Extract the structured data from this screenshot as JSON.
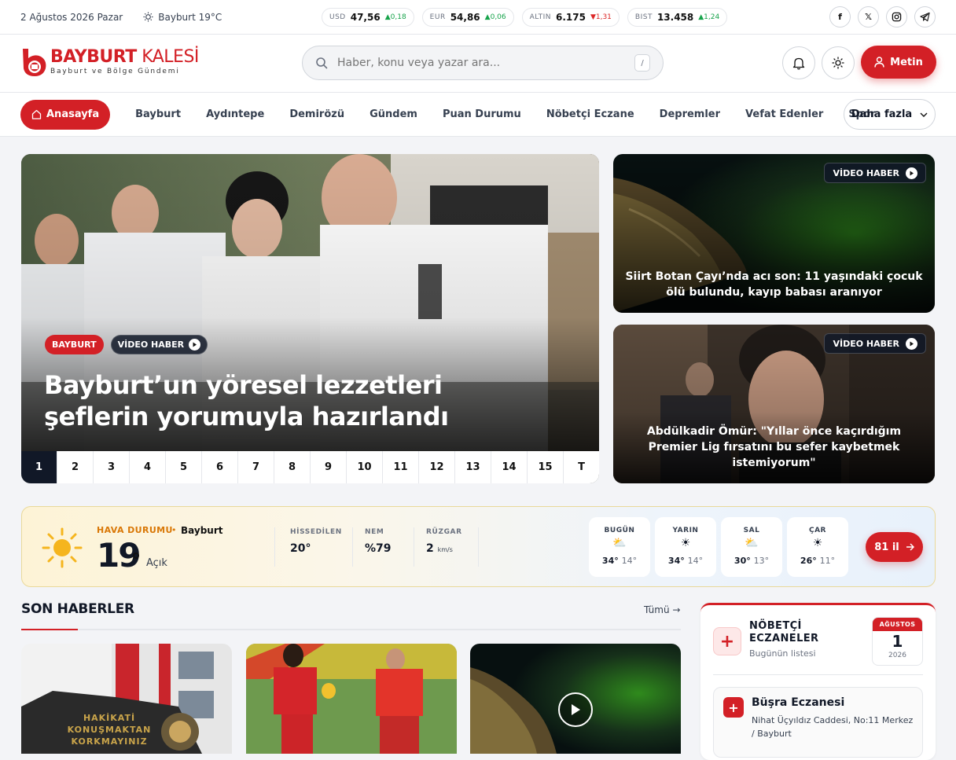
{
  "topbar": {
    "date": "2 Ağustos 2026 Pazar",
    "weather": "Bayburt 19°C",
    "tickers": [
      {
        "label": "USD",
        "value": "47,56",
        "change": "▲0,18",
        "dir": "up"
      },
      {
        "label": "EUR",
        "value": "54,86",
        "change": "▲0,06",
        "dir": "up"
      },
      {
        "label": "ALTIN",
        "value": "6.175",
        "change": "▼1,31",
        "dir": "down"
      },
      {
        "label": "BIST",
        "value": "13.458",
        "change": "▲1,24",
        "dir": "up"
      }
    ],
    "socials": [
      "facebook-icon",
      "x-icon",
      "instagram-icon",
      "telegram-icon"
    ]
  },
  "header": {
    "logo_title_bold": "BAYBURT",
    "logo_title_light": " KALESİ",
    "logo_subtitle": "Bayburt ve Bölge Gündemi",
    "search_placeholder": "Haber, konu veya yazar ara...",
    "search_shortcut": "/",
    "login_label": "Metin"
  },
  "nav": {
    "home": "Anasayfa",
    "items": [
      "Bayburt",
      "Aydıntepe",
      "Demirözü",
      "Gündem",
      "Puan Durumu",
      "Nöbetçi Eczane",
      "Depremler",
      "Vefat Edenler",
      "Spor"
    ],
    "more": "Daha fazla"
  },
  "hero": {
    "category": "BAYBURT",
    "video_tag": "VİDEO HABER",
    "title": "Bayburt’un yöresel lezzetleri şeflerin yorumuyla hazırlandı",
    "pages": [
      "1",
      "2",
      "3",
      "4",
      "5",
      "6",
      "7",
      "8",
      "9",
      "10",
      "11",
      "12",
      "13",
      "14",
      "15",
      "T"
    ],
    "active_page": "1"
  },
  "side_news": [
    {
      "tag": "VİDEO HABER",
      "title": "Siirt Botan Çayı’nda acı son: 11 yaşındaki çocuk ölü bulundu, kayıp babası aranıyor"
    },
    {
      "tag": "VİDEO HABER",
      "title": "Abdülkadir Ömür: \"Yıllar önce kaçırdığım Premier Lig fırsatını bu sefer kaybetmek istemiyorum\""
    }
  ],
  "weather": {
    "label": "HAVA DURUMU",
    "city": "Bayburt",
    "temp": "19",
    "desc": "Açık",
    "stats": [
      {
        "key": "HİSSEDİLEN",
        "value": "20°",
        "unit": ""
      },
      {
        "key": "NEM",
        "value": "%79",
        "unit": ""
      },
      {
        "key": "RÜZGAR",
        "value": "2",
        "unit": "km/s"
      }
    ],
    "forecast": [
      {
        "day": "BUGÜN",
        "icon": "partly-cloudy-icon",
        "glyph": "⛅",
        "high": "34°",
        "low": "14°"
      },
      {
        "day": "YARIN",
        "icon": "sun-icon",
        "glyph": "☀",
        "high": "34°",
        "low": "14°"
      },
      {
        "day": "SAL",
        "icon": "partly-cloudy-icon",
        "glyph": "⛅",
        "high": "30°",
        "low": "13°"
      },
      {
        "day": "ÇAR",
        "icon": "sun-icon",
        "glyph": "☀",
        "high": "26°",
        "low": "11°"
      }
    ],
    "cities_button": "81 il"
  },
  "latest": {
    "title": "SON HABERLER",
    "all_link": "Tümü →",
    "card1_text": [
      "HAKİKATİ",
      "KONUŞMAKTAN",
      "KORKMAYINIZ"
    ]
  },
  "pharmacy": {
    "title_line1": "NÖBETÇİ",
    "title_line2": "ECZANELER",
    "subtitle": "Bugünün listesi",
    "cal_month": "AĞUSTOS",
    "cal_day": "1",
    "cal_year": "2026",
    "item_name": "Büşra Eczanesi",
    "item_address": "Nihat Üçyıldız Caddesi, No:11 Merkez / Bayburt"
  },
  "colors": {
    "accent": "#d32026",
    "dark": "#111827",
    "gold": "#d97706"
  }
}
